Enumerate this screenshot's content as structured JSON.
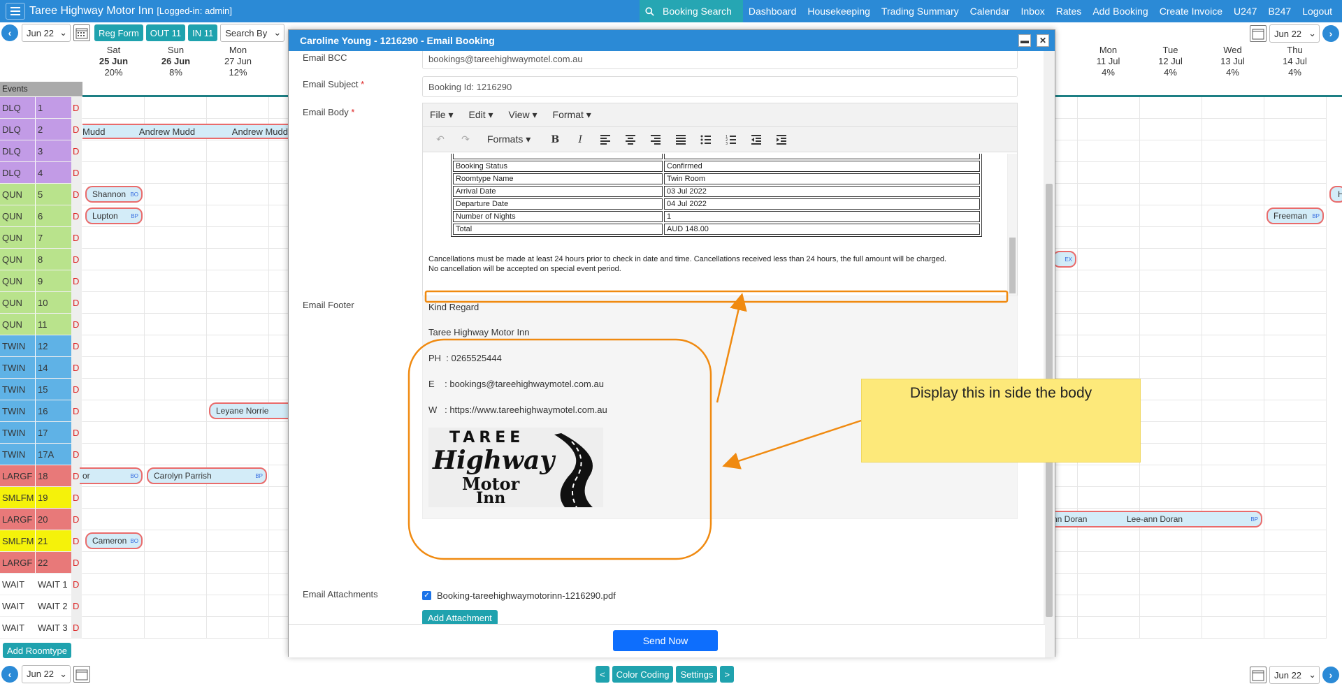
{
  "app": {
    "title": "Taree Highway Motor Inn",
    "login_status": "[Logged-in: admin]"
  },
  "nav": {
    "booking_search": "Booking Search",
    "items": [
      "Dashboard",
      "Housekeeping",
      "Trading Summary",
      "Calendar",
      "Inbox",
      "Rates",
      "Add Booking",
      "Create Invoice",
      "U247",
      "B247",
      "Logout"
    ]
  },
  "toolbar": {
    "month_left": "Jun 22",
    "reg_form": "Reg Form",
    "out": "OUT 11",
    "in": "IN 11",
    "search_by": "Search By",
    "month_right": "Jun 22"
  },
  "columns_left": [
    {
      "day": "Sat",
      "date": "25 Jun",
      "pct": "20%"
    },
    {
      "day": "Sun",
      "date": "26 Jun",
      "pct": "8%"
    },
    {
      "day": "Mon",
      "date": "27 Jun",
      "pct": "12%"
    }
  ],
  "columns_right": [
    {
      "day": "Mon",
      "date": "11 Jul",
      "pct": "4%"
    },
    {
      "day": "Tue",
      "date": "12 Jul",
      "pct": "4%"
    },
    {
      "day": "Wed",
      "date": "13 Jul",
      "pct": "4%"
    },
    {
      "day": "Thu",
      "date": "14 Jul",
      "pct": "4%"
    }
  ],
  "events_label": "Events",
  "rows": [
    {
      "type": "DLQ",
      "num": "1",
      "d": "D",
      "color": "#c29be6"
    },
    {
      "type": "DLQ",
      "num": "2",
      "d": "D",
      "color": "#c29be6"
    },
    {
      "type": "DLQ",
      "num": "3",
      "d": "D",
      "color": "#c29be6"
    },
    {
      "type": "DLQ",
      "num": "4",
      "d": "D",
      "color": "#c29be6"
    },
    {
      "type": "QUN",
      "num": "5",
      "d": "D",
      "color": "#b9e38c"
    },
    {
      "type": "QUN",
      "num": "6",
      "d": "D",
      "color": "#b9e38c"
    },
    {
      "type": "QUN",
      "num": "7",
      "d": "D",
      "color": "#b9e38c"
    },
    {
      "type": "QUN",
      "num": "8",
      "d": "D",
      "color": "#b9e38c"
    },
    {
      "type": "QUN",
      "num": "9",
      "d": "D",
      "color": "#b9e38c"
    },
    {
      "type": "QUN",
      "num": "10",
      "d": "D",
      "color": "#b9e38c"
    },
    {
      "type": "QUN",
      "num": "11",
      "d": "D",
      "color": "#b9e38c"
    },
    {
      "type": "TWIN",
      "num": "12",
      "d": "D",
      "color": "#5fb2e6"
    },
    {
      "type": "TWIN",
      "num": "14",
      "d": "D",
      "color": "#5fb2e6"
    },
    {
      "type": "TWIN",
      "num": "15",
      "d": "D",
      "color": "#5fb2e6"
    },
    {
      "type": "TWIN",
      "num": "16",
      "d": "D",
      "color": "#5fb2e6"
    },
    {
      "type": "TWIN",
      "num": "17",
      "d": "D",
      "color": "#5fb2e6"
    },
    {
      "type": "TWIN",
      "num": "17A",
      "d": "D",
      "color": "#5fb2e6"
    },
    {
      "type": "LARGF",
      "num": "18",
      "d": "D",
      "color": "#e87979"
    },
    {
      "type": "SMLFM",
      "num": "19",
      "d": "D",
      "color": "#f5f20a"
    },
    {
      "type": "LARGF",
      "num": "20",
      "d": "D",
      "color": "#e87979"
    },
    {
      "type": "SMLFM",
      "num": "21",
      "d": "D",
      "color": "#f5f20a"
    },
    {
      "type": "LARGF",
      "num": "22",
      "d": "D",
      "color": "#e87979"
    },
    {
      "type": "WAIT",
      "num": "WAIT 1",
      "d": "D",
      "color": "#ffffff"
    },
    {
      "type": "WAIT",
      "num": "WAIT 2",
      "d": "D",
      "color": "#ffffff"
    },
    {
      "type": "WAIT",
      "num": "WAIT 3",
      "d": "D",
      "color": "#ffffff"
    }
  ],
  "bookings": {
    "mudd1": "Mudd",
    "mudd2": "Andrew Mudd",
    "mudd3": "Andrew Mudd",
    "shannon": "Shannon",
    "lupton": "Lupton",
    "freeman": "Freeman",
    "norrie": "Leyane Norrie",
    "or": "or",
    "parrish": "Carolyn Parrish",
    "doran1": "nn Doran",
    "doran2": "Lee-ann Doran",
    "cameron": "Cameron",
    "tag_bo": "BO",
    "tag_bp": "BP",
    "tag_ex": "EX",
    "h": "H"
  },
  "add_roomtype": "Add Roomtype",
  "footer_bar": {
    "month_left": "Jun 22",
    "prev": "<",
    "color_coding": "Color Coding",
    "settings": "Settings",
    "next": ">",
    "month_right": "Jun 22"
  },
  "modal": {
    "title": "Caroline Young - 1216290 - Email Booking",
    "bcc_label": "Email BCC",
    "bcc_value": "bookings@tareehighwaymotel.com.au",
    "subject_label": "Email Subject",
    "subject_value": "Booking Id: 1216290",
    "body_label": "Email Body",
    "menus": [
      "File",
      "Edit",
      "View",
      "Format"
    ],
    "formats": "Formats",
    "booking_table": [
      {
        "k": "Booking Status",
        "v": "Confirmed"
      },
      {
        "k": "Roomtype Name",
        "v": "Twin Room"
      },
      {
        "k": "Arrival Date",
        "v": "03 Jul 2022"
      },
      {
        "k": "Departure Date",
        "v": "04 Jul 2022"
      },
      {
        "k": "Number of Nights",
        "v": "1"
      },
      {
        "k": "Total",
        "v": "AUD 148.00"
      }
    ],
    "cancel_line1": "Cancellations must be made at least 24 hours prior to check in date and time. Cancellations received less than 24 hours, the full amount will be charged.",
    "cancel_line2": "No cancellation will be accepted on special event period.",
    "status_path": "p",
    "footer_label": "Email Footer",
    "footer_lines": [
      "Kind Regard",
      "Taree Highway Motor Inn",
      "PH  : 0265525444",
      "E    : bookings@tareehighwaymotel.com.au",
      "W   : https://www.tareehighwaymotel.com.au"
    ],
    "logo_top": "TAREE",
    "logo_mid": "Highway",
    "logo_bot1": "Motor",
    "logo_bot2": "Inn",
    "attachments_label": "Email Attachments",
    "attachment_file": "Booking-tareehighwaymotorinn-1216290.pdf",
    "add_attachment": "Add Attachment",
    "send": "Send Now"
  },
  "annotation": {
    "note": "Display this in side the body",
    "color": "#f08a10"
  }
}
